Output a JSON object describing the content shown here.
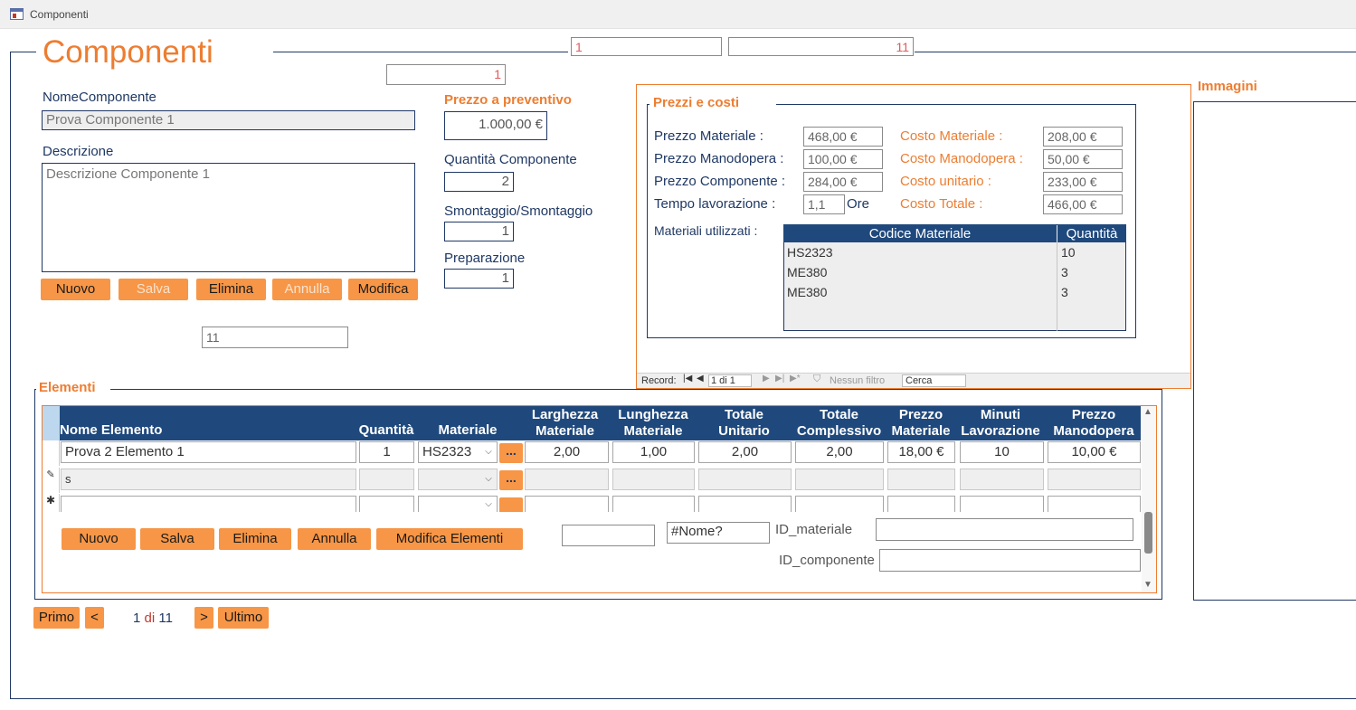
{
  "window": {
    "title": "Componenti"
  },
  "form": {
    "title": "Componenti",
    "top_field_1": "1",
    "top_field_2": "11",
    "id_field": "1",
    "nome_label": "NomeComponente",
    "nome_value": "Prova Componente 1",
    "descr_label": "Descrizione",
    "descr_value": "Descrizione Componente 1",
    "prezzo_prev_label": "Prezzo a preventivo",
    "prezzo_prev_value": "1.000,00 €",
    "qta_label": "Quantità Componente",
    "qta_value": "2",
    "smont_label": "Smontaggio/Smontaggio",
    "smont_value": "1",
    "prep_label": "Preparazione",
    "prep_value": "1",
    "count_field": "11",
    "buttons": {
      "nuovo": "Nuovo",
      "salva": "Salva",
      "elimina": "Elimina",
      "annulla": "Annulla",
      "modifica": "Modifica"
    }
  },
  "prezzi": {
    "title": "Prezzi e costi",
    "prezzo_materiale_label": "Prezzo Materiale :",
    "prezzo_materiale": "468,00 €",
    "prezzo_manodopera_label": "Prezzo Manodopera :",
    "prezzo_manodopera": "100,00 €",
    "prezzo_componente_label": "Prezzo Componente :",
    "prezzo_componente": "284,00 €",
    "tempo_label": "Tempo lavorazione :",
    "tempo": "1,1",
    "ore": "Ore",
    "costo_materiale_label": "Costo Materiale :",
    "costo_materiale": "208,00 €",
    "costo_manodopera_label": "Costo Manodopera :",
    "costo_manodopera": "50,00 €",
    "costo_unitario_label": "Costo unitario :",
    "costo_unitario": "233,00 €",
    "costo_totale_label": "Costo Totale :",
    "costo_totale": "466,00 €",
    "materiali_label": "Materiali utilizzati :",
    "mat_headers": [
      "Codice Materiale",
      "Quantità"
    ],
    "mat_rows": [
      {
        "codice": "HS2323",
        "qta": "10"
      },
      {
        "codice": "ME380",
        "qta": "3"
      },
      {
        "codice": "ME380",
        "qta": "3"
      }
    ],
    "recbar": {
      "record": "Record:",
      "pos": "1 di 1",
      "filter": "Nessun filtro",
      "search": "Cerca"
    }
  },
  "immagini": {
    "title": "Immagini"
  },
  "elementi": {
    "title": "Elementi",
    "headers": [
      "Nome Elemento",
      "Quantità",
      "Materiale",
      "Larghezza Materiale",
      "Lunghezza Materiale",
      "Totale Unitario",
      "Totale Complessivo",
      "Prezzo Materiale",
      "Minuti Lavorazione",
      "Prezzo Manodopera"
    ],
    "row1": {
      "nome": "Prova 2 Elemento 1",
      "qta": "1",
      "materiale": "HS2323",
      "larghezza": "2,00",
      "lunghezza": "1,00",
      "tot_unit": "2,00",
      "tot_compl": "2,00",
      "prezzo_mat": "18,00 €",
      "minuti": "10",
      "prezzo_mano": "10,00 €"
    },
    "row2": {
      "nome": "s"
    },
    "dots": "...",
    "buttons": {
      "nuovo": "Nuovo",
      "salva": "Salva",
      "elimina": "Elimina",
      "annulla": "Annulla",
      "modifica": "Modifica Elementi"
    },
    "nome_err": "#Nome?",
    "id_materiale_label": "ID_materiale",
    "id_componente_label": "ID_componente"
  },
  "nav": {
    "primo": "Primo",
    "prev": "<",
    "pos_a": "1",
    "pos_di": "di",
    "pos_b": "11",
    "next": ">",
    "ultimo": "Ultimo"
  }
}
